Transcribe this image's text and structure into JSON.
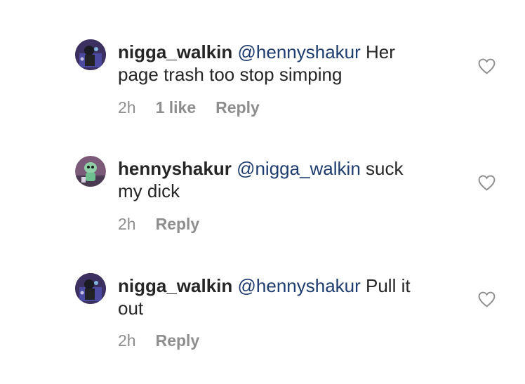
{
  "comments": [
    {
      "username": "nigga_walkin",
      "mention": "@hennyshakur",
      "text_line1": " Her",
      "text_line2": "page trash too stop simping",
      "time": "2h",
      "likes": "1 like",
      "reply_label": "Reply",
      "avatar_icon": "dark-blue-figure-avatar"
    },
    {
      "username": "hennyshakur",
      "mention": "@nigga_walkin",
      "text_line1": " suck",
      "text_line2": "my dick",
      "time": "2h",
      "likes": "",
      "reply_label": "Reply",
      "avatar_icon": "green-cartoon-avatar"
    },
    {
      "username": "nigga_walkin",
      "mention": "@hennyshakur",
      "text_line1": " Pull it",
      "text_line2": "out",
      "time": "2h",
      "likes": "",
      "reply_label": "Reply",
      "avatar_icon": "dark-blue-figure-avatar"
    }
  ],
  "colors": {
    "mention": "#1e3c6e",
    "meta": "#8e8e8e",
    "text": "#262626"
  }
}
